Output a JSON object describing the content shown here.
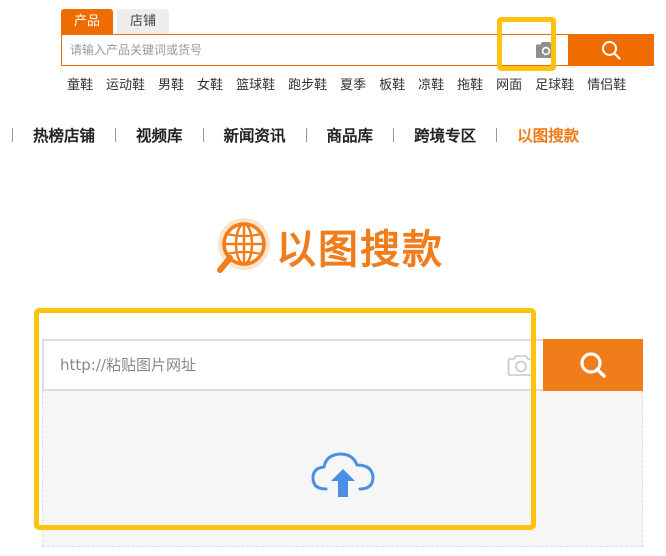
{
  "colors": {
    "accent": "#ef6c00",
    "highlight": "#ffc20e",
    "upload_icon": "#4a90e2"
  },
  "top_search": {
    "tabs": [
      {
        "label": "产品",
        "active": true
      },
      {
        "label": "店铺",
        "active": false
      }
    ],
    "placeholder": "请输入产品关键词或货号",
    "camera_icon": "camera-icon",
    "search_icon": "search-icon"
  },
  "hot_words": [
    "童鞋",
    "运动鞋",
    "男鞋",
    "女鞋",
    "篮球鞋",
    "跑步鞋",
    "夏季",
    "板鞋",
    "凉鞋",
    "拖鞋",
    "网面",
    "足球鞋",
    "情侣鞋"
  ],
  "nav": {
    "items": [
      {
        "label": "热榜店铺",
        "active": false
      },
      {
        "label": "视频库",
        "active": false
      },
      {
        "label": "新闻资讯",
        "active": false
      },
      {
        "label": "商品库",
        "active": false
      },
      {
        "label": "跨境专区",
        "active": false
      },
      {
        "label": "以图搜款",
        "active": true
      }
    ]
  },
  "logo": {
    "text": "以图搜款",
    "icon": "globe-search-icon"
  },
  "image_search": {
    "placeholder": "http://粘贴图片网址",
    "camera_icon": "camera-icon",
    "search_icon": "search-icon",
    "upload_icon": "cloud-upload-icon"
  }
}
